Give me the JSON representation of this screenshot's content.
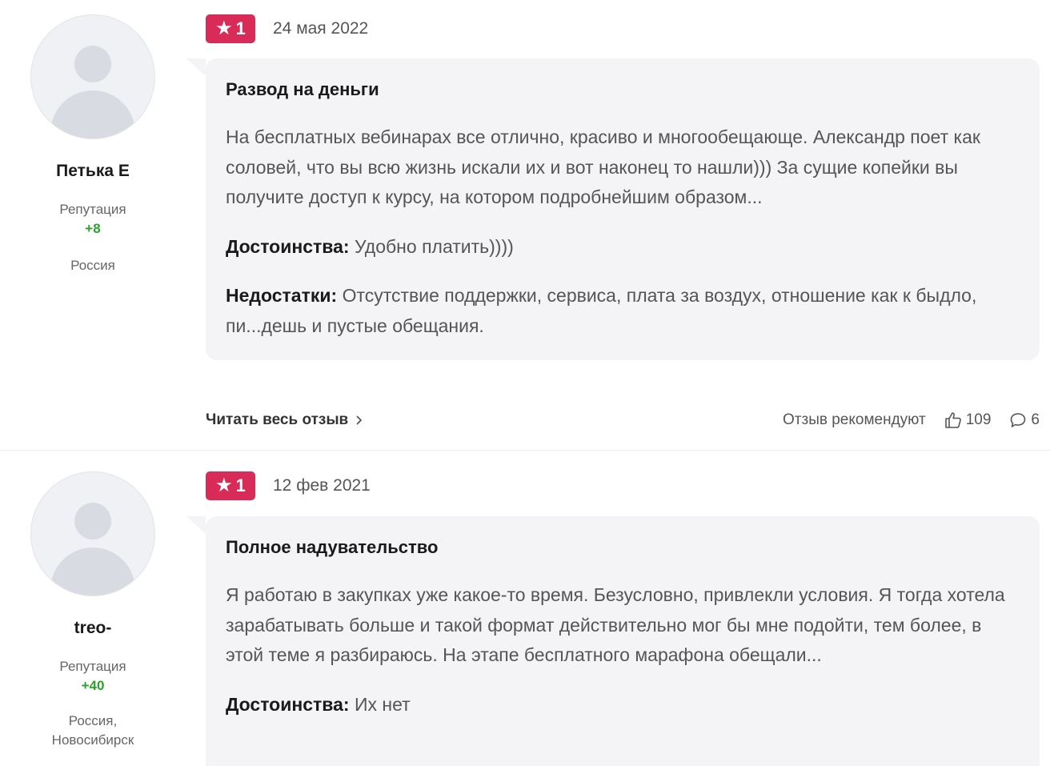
{
  "reviews": [
    {
      "author": {
        "name": "Петька Е",
        "reputation_label": "Репутация",
        "reputation_value": "+8",
        "country": "Россия"
      },
      "rating": "1",
      "date": "24 мая 2022",
      "title": "Развод на деньги",
      "text": "На бесплатных вебинарах все отлично, красиво и многообещающе. Александр поет как соловей, что вы всю жизнь искали их и вот наконец то нашли))) За сущие копейки вы получите доступ к курсу, на котором подробнейшим образом...",
      "pros_label": "Достоинства:",
      "pros": "Удобно платить))))",
      "cons_label": "Недостатки:",
      "cons": "Отсутствие поддержки, сервиса, плата за воздух, отношение как к быдло, пи...дешь и пустые обещания.",
      "read_more": "Читать весь отзыв",
      "recommend": "Отзыв рекомендуют",
      "likes": "109",
      "comments": "6"
    },
    {
      "author": {
        "name": "treo-",
        "reputation_label": "Репутация",
        "reputation_value": "+40",
        "country": "Россия, Новосибирск"
      },
      "rating": "1",
      "date": "12 фев 2021",
      "title": "Полное надувательство",
      "text": "Я работаю в закупках уже какое-то время. Безусловно, привлекли условия. Я тогда хотела зарабатывать больше и такой формат действительно мог бы мне подойти, тем более, в этой теме я разбираюсь. На этапе бесплатного марафона обещали...",
      "pros_label": "Достоинства:",
      "pros": "Их нет"
    }
  ],
  "icons": {
    "star": "star-icon",
    "thumb": "thumbs-up-icon",
    "comment": "comment-icon",
    "chevron": "chevron-right-icon"
  },
  "colors": {
    "badge": "#d92b57",
    "reputation": "#29a329",
    "card_bg": "#f4f4f7"
  }
}
